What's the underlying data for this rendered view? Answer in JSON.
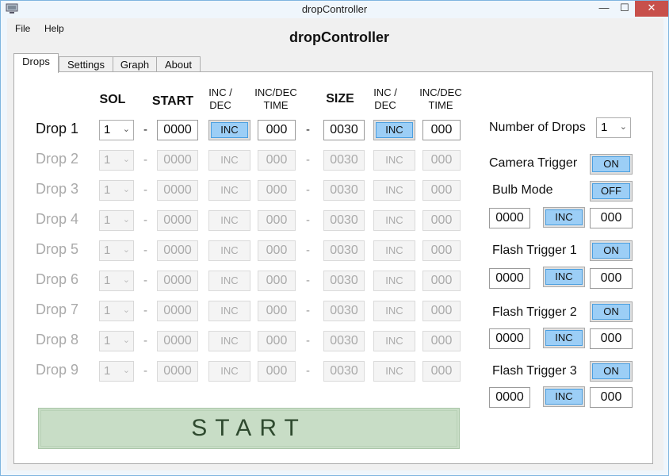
{
  "window": {
    "title": "dropController",
    "controls": {
      "minimize": "—",
      "maximize": "☐",
      "close": "✕"
    }
  },
  "menu": {
    "file": "File",
    "help": "Help"
  },
  "app_title": "dropController",
  "tabs": [
    "Drops",
    "Settings",
    "Graph",
    "About"
  ],
  "headers": {
    "sol": "SOL",
    "start": "START",
    "inc_dec": "INC / DEC",
    "inc_dec_time": "INC/DEC TIME",
    "size": "SIZE"
  },
  "drops": [
    {
      "label": "Drop 1",
      "sol": "1",
      "start": "0000",
      "inc": "INC",
      "time": "000",
      "size": "0030",
      "size_inc": "INC",
      "size_time": "000",
      "enabled": true
    },
    {
      "label": "Drop 2",
      "sol": "1",
      "start": "0000",
      "inc": "INC",
      "time": "000",
      "size": "0030",
      "size_inc": "INC",
      "size_time": "000",
      "enabled": false
    },
    {
      "label": "Drop 3",
      "sol": "1",
      "start": "0000",
      "inc": "INC",
      "time": "000",
      "size": "0030",
      "size_inc": "INC",
      "size_time": "000",
      "enabled": false
    },
    {
      "label": "Drop 4",
      "sol": "1",
      "start": "0000",
      "inc": "INC",
      "time": "000",
      "size": "0030",
      "size_inc": "INC",
      "size_time": "000",
      "enabled": false
    },
    {
      "label": "Drop 5",
      "sol": "1",
      "start": "0000",
      "inc": "INC",
      "time": "000",
      "size": "0030",
      "size_inc": "INC",
      "size_time": "000",
      "enabled": false
    },
    {
      "label": "Drop 6",
      "sol": "1",
      "start": "0000",
      "inc": "INC",
      "time": "000",
      "size": "0030",
      "size_inc": "INC",
      "size_time": "000",
      "enabled": false
    },
    {
      "label": "Drop 7",
      "sol": "1",
      "start": "0000",
      "inc": "INC",
      "time": "000",
      "size": "0030",
      "size_inc": "INC",
      "size_time": "000",
      "enabled": false
    },
    {
      "label": "Drop 8",
      "sol": "1",
      "start": "0000",
      "inc": "INC",
      "time": "000",
      "size": "0030",
      "size_inc": "INC",
      "size_time": "000",
      "enabled": false
    },
    {
      "label": "Drop 9",
      "sol": "1",
      "start": "0000",
      "inc": "INC",
      "time": "000",
      "size": "0030",
      "size_inc": "INC",
      "size_time": "000",
      "enabled": false
    }
  ],
  "dash": "-",
  "side": {
    "number_of_drops_label": "Number of Drops",
    "number_of_drops_value": "1",
    "camera_trigger_label": "Camera Trigger",
    "camera_trigger_state": "ON",
    "bulb_mode_label": "Bulb Mode",
    "bulb_mode_state": "OFF",
    "bulb": {
      "start": "0000",
      "inc": "INC",
      "time": "000"
    },
    "flash1_label": "Flash Trigger 1",
    "flash1_state": "ON",
    "flash1": {
      "start": "0000",
      "inc": "INC",
      "time": "000"
    },
    "flash2_label": "Flash Trigger 2",
    "flash2_state": "ON",
    "flash2": {
      "start": "0000",
      "inc": "INC",
      "time": "000"
    },
    "flash3_label": "Flash Trigger 3",
    "flash3_state": "ON",
    "flash3": {
      "start": "0000",
      "inc": "INC",
      "time": "000"
    }
  },
  "start_button": "START",
  "colors": {
    "toggle_on": "#9ccef6",
    "start_button": "#c8ddc6"
  }
}
